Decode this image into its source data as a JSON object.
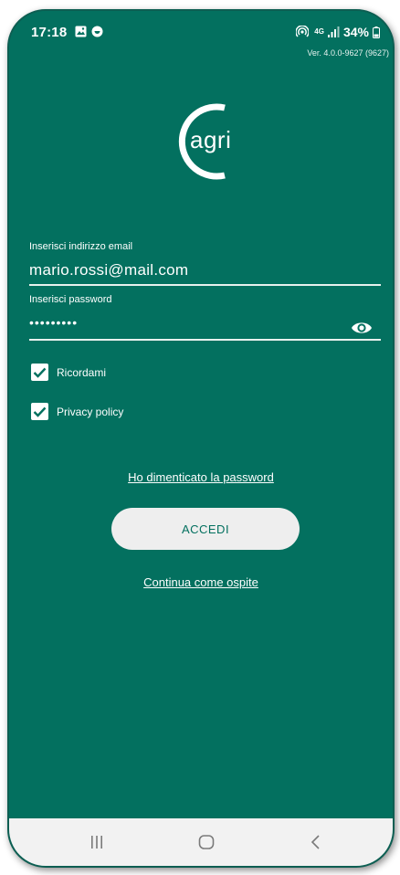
{
  "status_bar": {
    "time": "17:18",
    "network": "4G",
    "battery": "34%",
    "icons": [
      "image-icon",
      "notification-icon",
      "hotspot-icon",
      "signal-icon",
      "battery-icon"
    ]
  },
  "app": {
    "version": "Ver. 4.0.0-9627 (9627)",
    "logo_text": "agri"
  },
  "form": {
    "email_label": "Inserisci indirizzo email",
    "email_value": "mario.rossi@mail.com",
    "password_label": "Inserisci password",
    "password_value": "•••••••••",
    "remember_label": "Ricordami",
    "remember_checked": true,
    "privacy_label": "Privacy policy",
    "privacy_checked": true
  },
  "actions": {
    "forgot_password": "Ho dimenticato la password",
    "login": "ACCEDI",
    "guest": "Continua come ospite"
  },
  "navigation": {
    "buttons": [
      "recent-apps-icon",
      "home-icon",
      "back-icon"
    ]
  },
  "colors": {
    "background": "#03705f",
    "button": "#eeeeee",
    "text": "#ffffff"
  }
}
